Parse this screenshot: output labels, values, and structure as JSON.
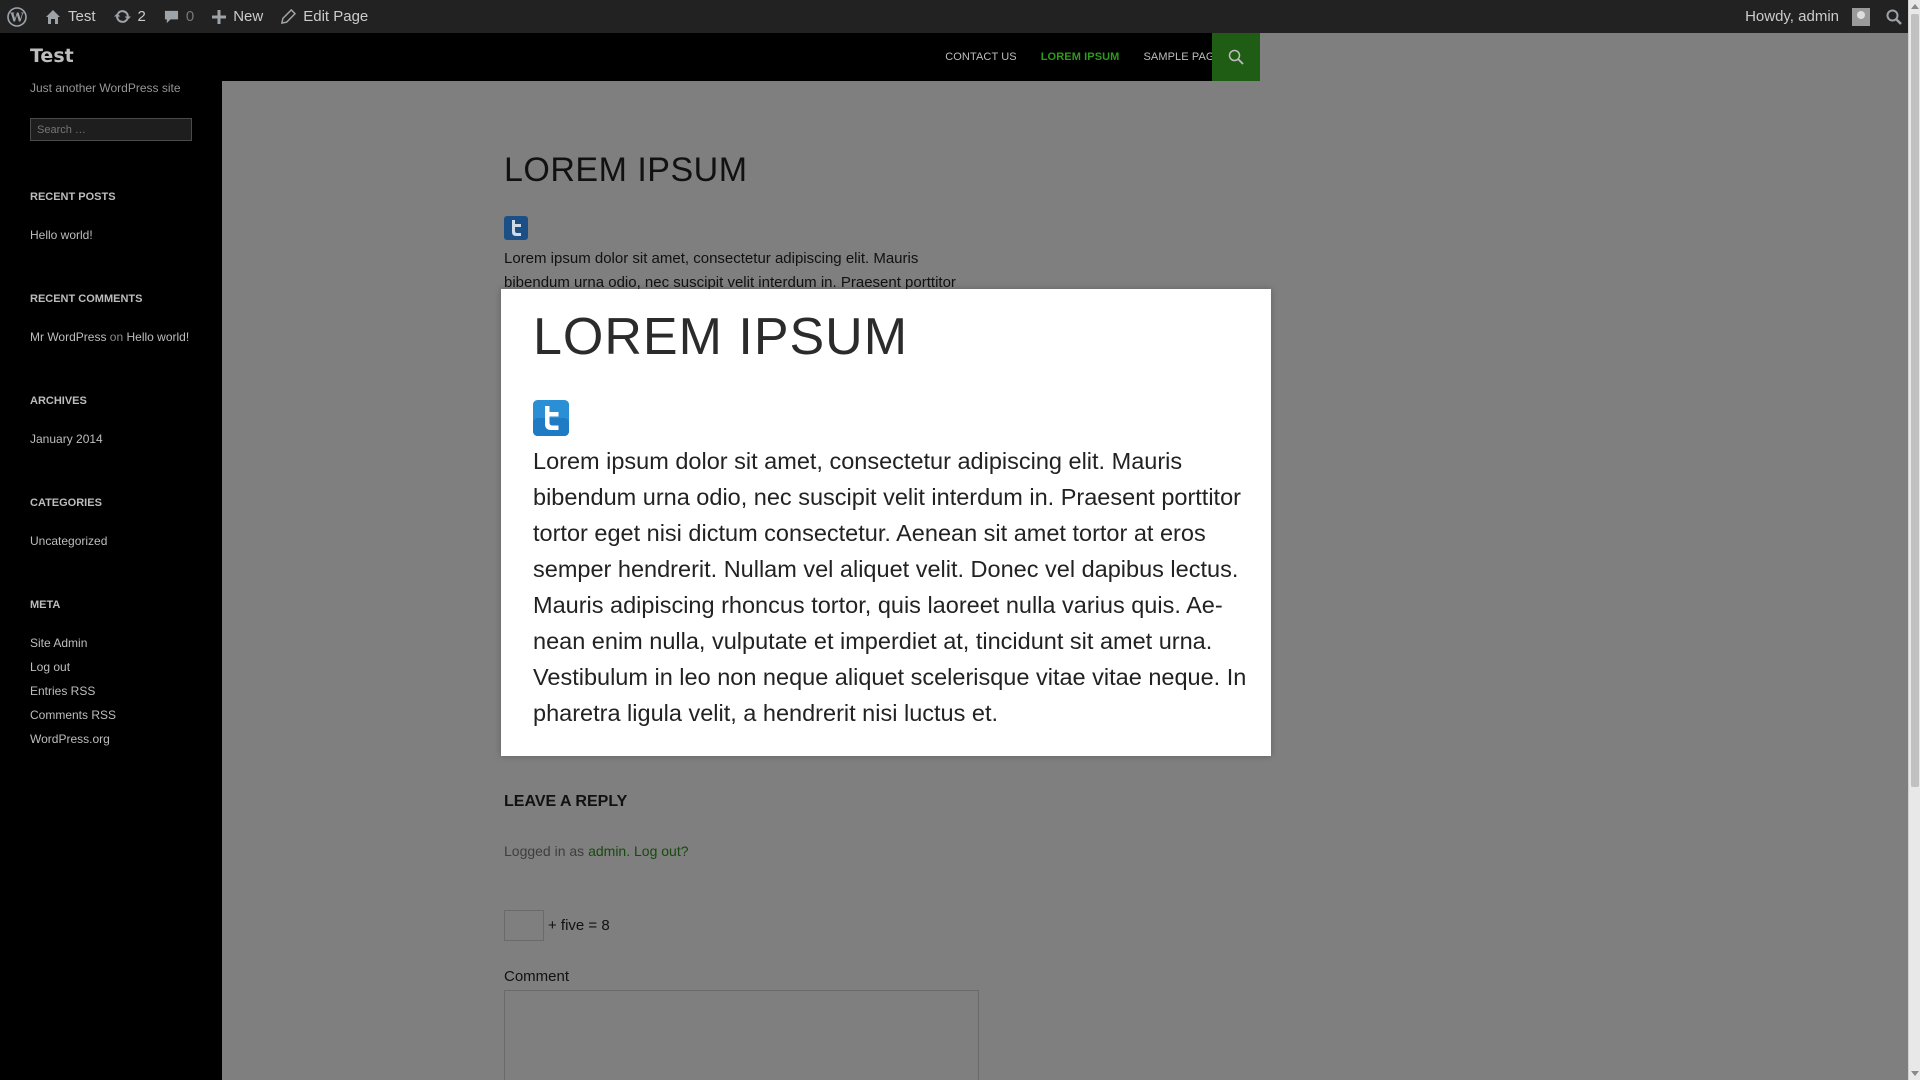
{
  "adminbar": {
    "site_name": "Test",
    "updates_count": "2",
    "comments_count": "0",
    "new_label": "New",
    "edit_label": "Edit Page",
    "greeting": "Howdy, admin"
  },
  "header": {
    "site_title": "Test",
    "nav": [
      "CONTACT US",
      "LOREM IPSUM",
      "SAMPLE PAGE"
    ],
    "active_nav": "LOREM IPSUM"
  },
  "sidebar": {
    "tagline": "Just another WordPress site",
    "search_placeholder": "Search …",
    "recent_posts_title": "RECENT POSTS",
    "recent_posts": [
      "Hello world!"
    ],
    "recent_comments_title": "RECENT COMMENTS",
    "recent_comment": {
      "author": "Mr WordPress",
      "on": "on",
      "post": "Hello world!"
    },
    "archives_title": "ARCHIVES",
    "archives": [
      "January 2014"
    ],
    "categories_title": "CATEGORIES",
    "categories": [
      "Uncategorized"
    ],
    "meta_title": "META",
    "meta": [
      "Site Admin",
      "Log out",
      "Entries RSS",
      "Comments RSS",
      "WordPress.org"
    ]
  },
  "content": {
    "page_title": "LOREM IPSUM",
    "body_preview": "Lorem ipsum dolor sit amet, consectetur adipiscing elit. Mauris bibendum urna odio, nec suscipit velit interdum in. Praesent porttitor",
    "reply_title": "LEAVE A REPLY",
    "logged_in_prefix": "Logged in as",
    "logged_in_user": "admin",
    "logout_link": "Log out?",
    "captcha_text": "+ five = 8",
    "comment_label": "Comment"
  },
  "overlay": {
    "title": "LOREM IPSUM",
    "body": "Lorem ipsum dolor sit amet, consectetur adipiscing elit. Mauris bibendum urna odio, nec suscipit velit interdum in. Praesent porttitor tortor eget nisi dictum consectetur. Aenean sit amet tortor at eros semper hendrerit. Nullam vel aliquet velit. Donec vel dapibus lectus. Mauris adipiscing rhoncus tortor, quis laoreet nulla varius quis. Ae-nean enim nulla, vulputate et imperdiet at, tincidunt sit amet urna. Vestibulum in leo non neque aliquet scelerisque vitae vitae neque. In pharetra ligula velit, a hendrerit nisi luctus et."
  },
  "colors": {
    "accent_green": "#2e9a1c",
    "admin_bar": "#222222",
    "dim_overlay": "#7f7f7f"
  },
  "icons": [
    "wordpress-logo-icon",
    "home-icon",
    "updates-icon",
    "comment-bubble-icon",
    "plus-icon",
    "pencil-icon",
    "search-icon",
    "twitter-icon"
  ]
}
